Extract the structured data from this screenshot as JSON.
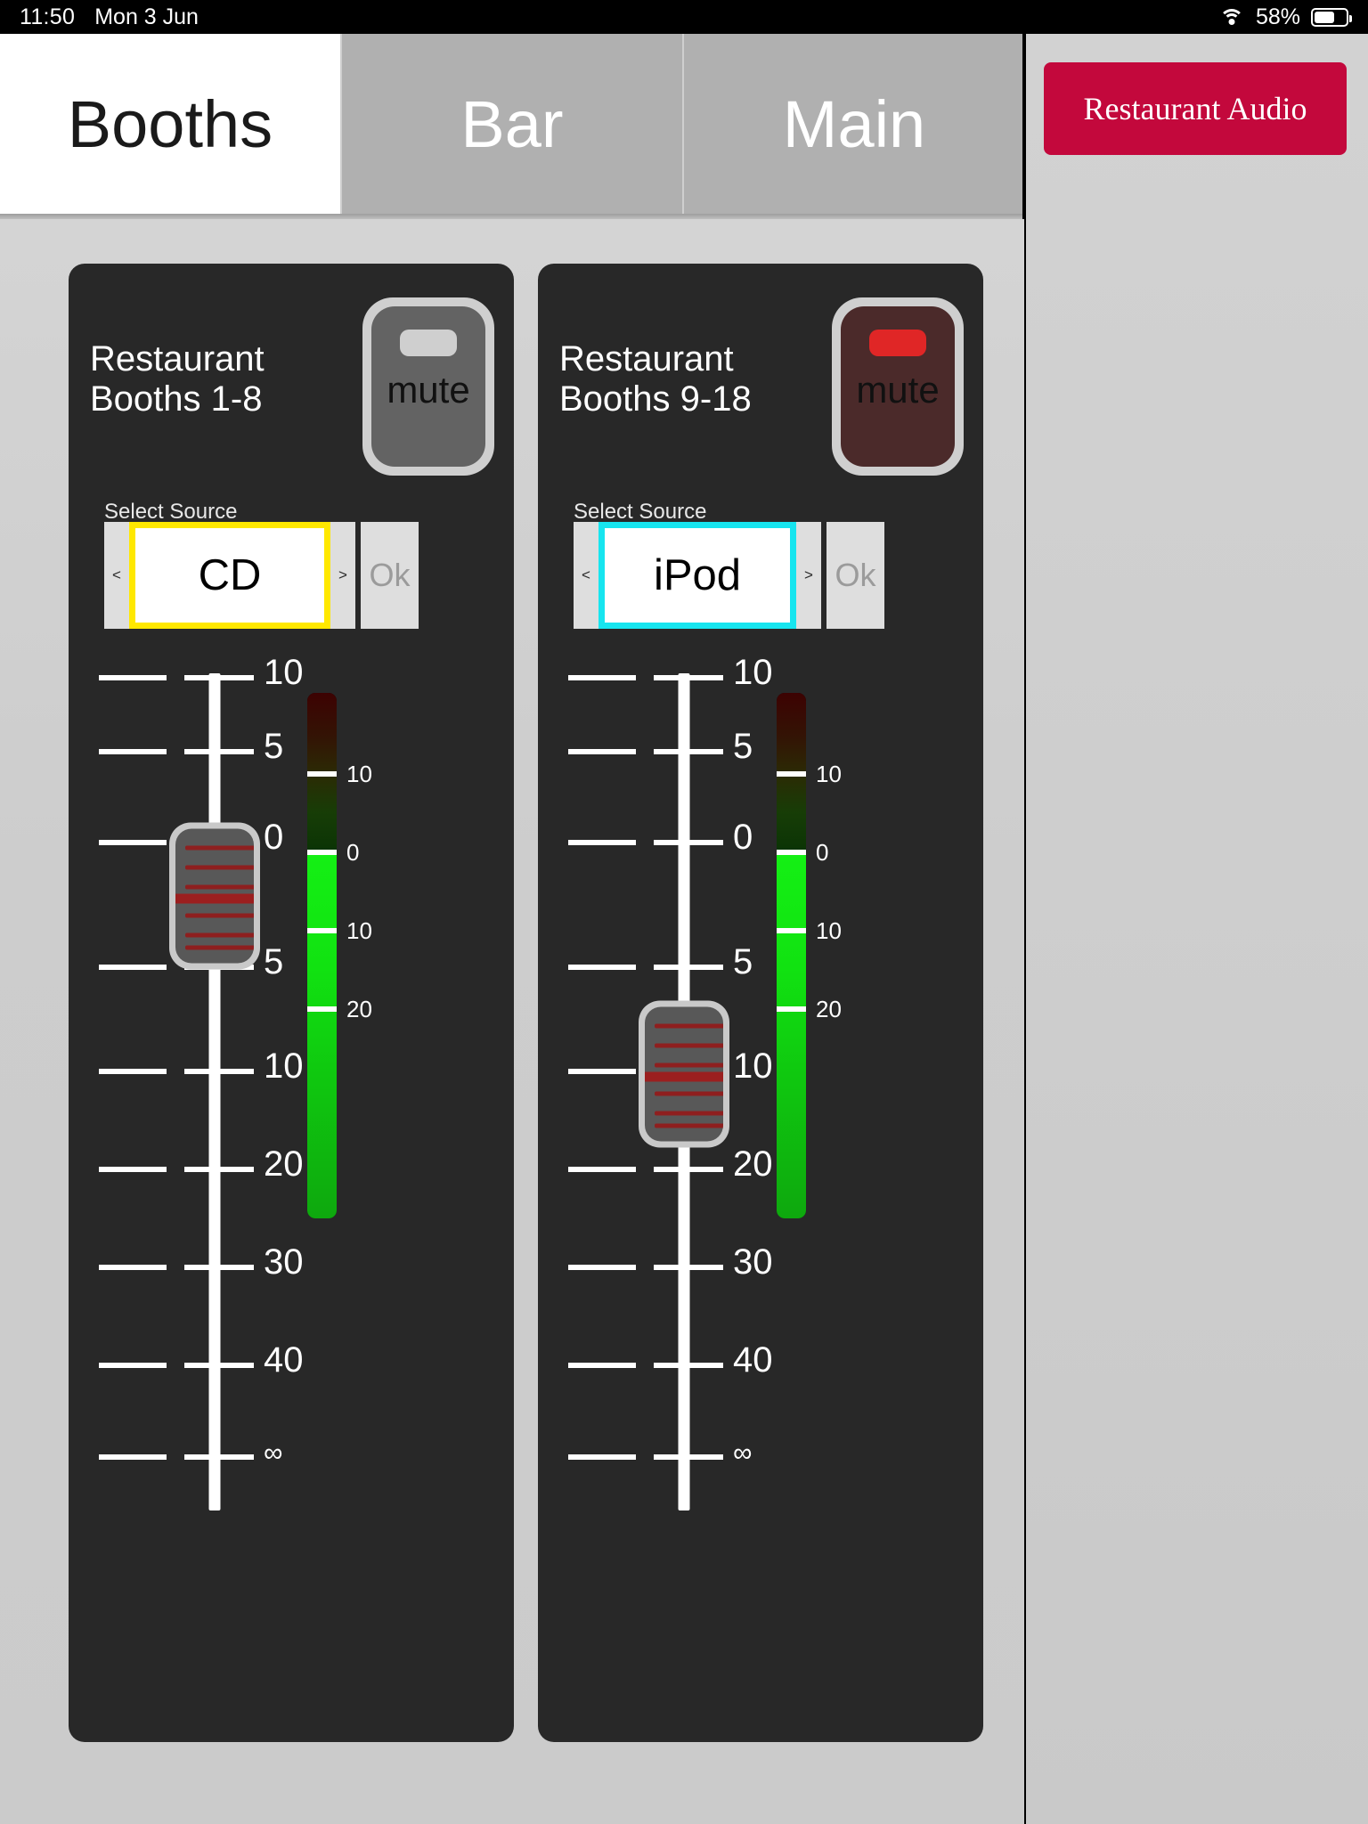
{
  "status_bar": {
    "time": "11:50",
    "date": "Mon 3 Jun",
    "battery_percent": "58%",
    "wifi_icon": "wifi-icon",
    "battery_icon": "battery-icon"
  },
  "tabs": [
    {
      "label": "Booths",
      "active": true
    },
    {
      "label": "Bar",
      "active": false
    },
    {
      "label": "Main",
      "active": false
    }
  ],
  "right_rail": {
    "button_label": "Restaurant Audio",
    "button_color": "#c3083c"
  },
  "panels": [
    {
      "title_line1": "Restaurant",
      "title_line2": "Booths 1-8",
      "mute": {
        "label": "mute",
        "active": false,
        "led_color": "#cfcfcf"
      },
      "source": {
        "label": "Select Source",
        "value": "CD",
        "prev_arrow": "<",
        "next_arrow": ">",
        "ok_label": "Ok",
        "highlight_color": "#ffe800"
      },
      "fader": {
        "ticks": [
          "10",
          "5",
          "0",
          "5",
          "10",
          "20",
          "30",
          "40",
          "∞"
        ],
        "handle_value": "0"
      },
      "meter": {
        "ticks": [
          "10",
          "0",
          "10",
          "20"
        ],
        "level_db": "0"
      }
    },
    {
      "title_line1": "Restaurant",
      "title_line2": "Booths 9-18",
      "mute": {
        "label": "mute",
        "active": true,
        "led_color": "#e02626"
      },
      "source": {
        "label": "Select Source",
        "value": "iPod",
        "prev_arrow": "<",
        "next_arrow": ">",
        "ok_label": "Ok",
        "highlight_color": "#17e5ef"
      },
      "fader": {
        "ticks": [
          "10",
          "5",
          "0",
          "5",
          "10",
          "20",
          "30",
          "40",
          "∞"
        ],
        "handle_value": "10"
      },
      "meter": {
        "ticks": [
          "10",
          "0",
          "10",
          "20"
        ],
        "level_db": "0"
      }
    }
  ]
}
